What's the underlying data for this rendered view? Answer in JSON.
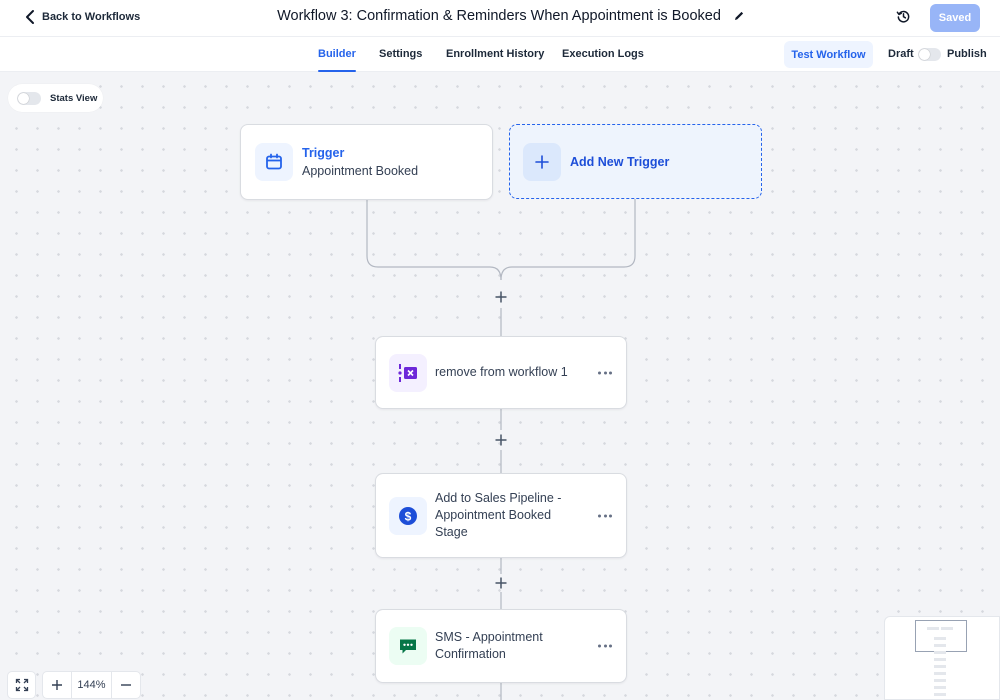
{
  "header": {
    "back_label": "Back to Workflows",
    "title": "Workflow 3: Confirmation & Reminders When Appointment is Booked",
    "saved_label": "Saved"
  },
  "tabs": [
    {
      "label": "Builder",
      "active": true
    },
    {
      "label": "Settings",
      "active": false
    },
    {
      "label": "Enrollment History",
      "active": false
    },
    {
      "label": "Execution Logs",
      "active": false
    }
  ],
  "actions": {
    "test_workflow_label": "Test Workflow",
    "draft_label": "Draft",
    "publish_label": "Publish",
    "published": false
  },
  "canvas": {
    "stats_view_label": "Stats View",
    "stats_view_on": false,
    "trigger": {
      "title": "Trigger",
      "subtitle": "Appointment Booked",
      "icon": "calendar-icon"
    },
    "add_trigger_label": "Add New Trigger",
    "steps": [
      {
        "label": "remove from workflow 1",
        "icon": "remove-from-workflow-icon",
        "color": "#6d28d9"
      },
      {
        "label": "Add to Sales Pipeline - Appointment Booked Stage",
        "icon": "dollar-icon",
        "color": "#1d4ed8"
      },
      {
        "label": "SMS - Appointment Confirmation",
        "icon": "sms-icon",
        "color": "#067647"
      }
    ]
  },
  "zoom": {
    "level": "144%"
  },
  "colors": {
    "accent": "#2563eb",
    "saved_button": "#98b5f7"
  }
}
